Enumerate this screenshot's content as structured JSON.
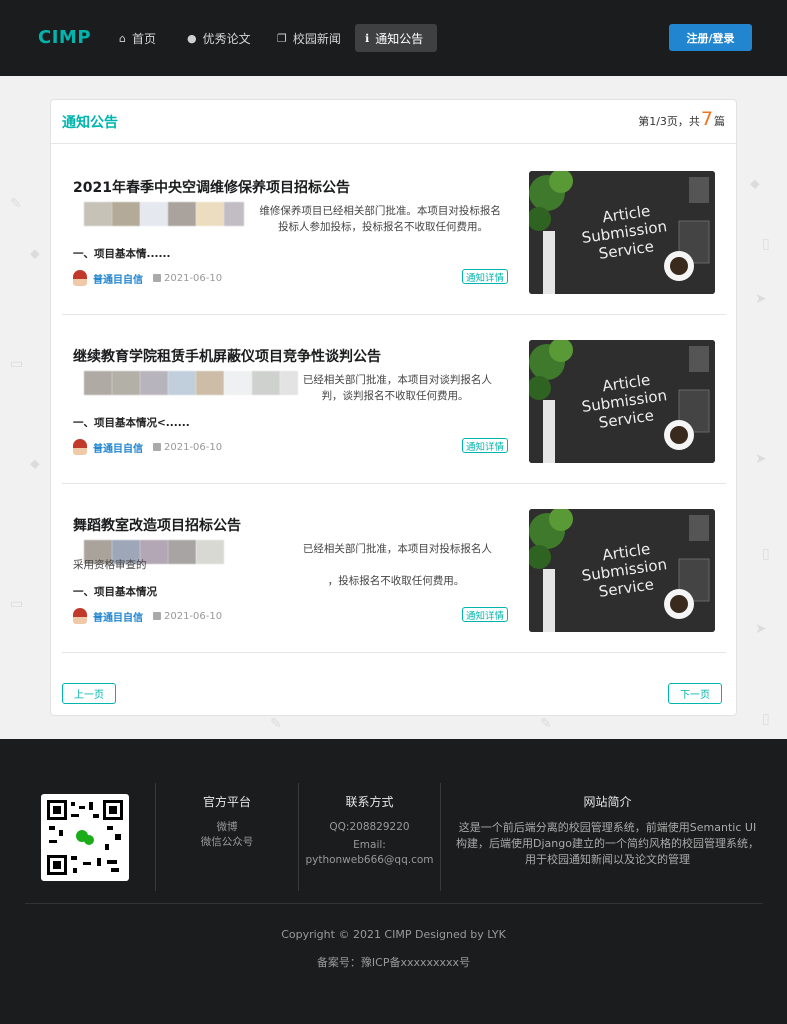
{
  "header": {
    "logo": "CIMP",
    "nav": [
      {
        "label": "首页",
        "icon": "home-icon",
        "glyph": "⌂"
      },
      {
        "label": "优秀论文",
        "icon": "lightbulb-icon",
        "glyph": "●"
      },
      {
        "label": "校园新闻",
        "icon": "copy-icon",
        "glyph": "❐"
      },
      {
        "label": "通知公告",
        "icon": "info-icon",
        "glyph": "ℹ"
      }
    ],
    "login": "注册/登录"
  },
  "card": {
    "title": "通知公告",
    "pager_prefix": "第1/3页，共",
    "total": "7",
    "pager_suffix": "篇"
  },
  "articles": [
    {
      "title": "2021年春季中央空调维修保养项目招标公告",
      "summary_visible_1": "维修保养项目已经相关部门批准。本项目对投标报名",
      "summary_visible_2": "投标人参加投标，投标报名不收取任何费用。",
      "sub": "一、项目基本情......",
      "author": "普通目自信",
      "date": "2021-06-10",
      "tag": "通知详情"
    },
    {
      "title": "继续教育学院租赁手机屏蔽仪项目竞争性谈判公告",
      "summary_visible_1": "已经相关部门批准，本项目对谈判报名人",
      "summary_visible_2": "判，谈判报名不收取任何费用。",
      "sub": "一、项目基本情况<......",
      "author": "普通目自信",
      "date": "2021-06-10",
      "tag": "通知详情"
    },
    {
      "title": "舞蹈教室改造项目招标公告",
      "summary_visible_1": "已经相关部门批准，本项目对投标报名人采用资格审查的",
      "summary_visible_2": "，投标报名不收取任何费用。",
      "sub": "一、项目基本情况",
      "author": "普通目自信",
      "date": "2021-06-10",
      "tag": "通知详情"
    }
  ],
  "thumb_text": [
    "Article",
    "Submission",
    "Service"
  ],
  "pagination": {
    "prev": "上一页",
    "next": "下一页"
  },
  "footer": {
    "col1": {
      "title": "官方平台",
      "lines": [
        "微博",
        "微信公众号"
      ]
    },
    "col2": {
      "title": "联系方式",
      "lines": [
        "QQ:208829220",
        "Email:",
        "pythonweb666@qq.com"
      ]
    },
    "col3": {
      "title": "网站简介",
      "desc": "这是一个前后端分离的校园管理系统，前端使用Semantic UI构建，后端使用Django建立的一个简约风格的校园管理系统，用于校园通知新闻以及论文的管理"
    },
    "copyright": "Copyright © 2021 CIMP Designed by LYK",
    "icp": "备案号：豫ICP备xxxxxxxxx号"
  },
  "colors": {
    "accent": "#00b5ad",
    "primary": "#2185d0",
    "orange": "#f2711c",
    "dark": "#1b1c1d"
  }
}
